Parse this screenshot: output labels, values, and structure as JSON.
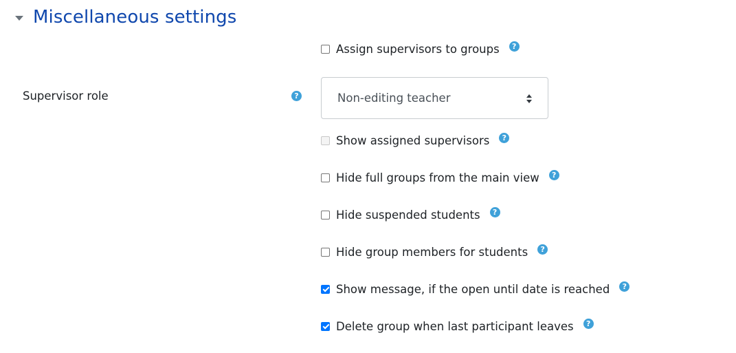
{
  "section": {
    "title": "Miscellaneous settings"
  },
  "supervisor_role": {
    "label": "Supervisor role",
    "selected": "Non-editing teacher"
  },
  "help_icon_glyph": "?",
  "checkboxes": [
    {
      "label": "Assign supervisors to groups",
      "checked": false,
      "disabled": false
    },
    {
      "label": "Show assigned supervisors",
      "checked": false,
      "disabled": true
    },
    {
      "label": "Hide full groups from the main view",
      "checked": false,
      "disabled": false
    },
    {
      "label": "Hide suspended students",
      "checked": false,
      "disabled": false
    },
    {
      "label": "Hide group members for students",
      "checked": false,
      "disabled": false
    },
    {
      "label": "Show message, if the open until date is reached",
      "checked": true,
      "disabled": false
    },
    {
      "label": "Delete group when last participant leaves",
      "checked": true,
      "disabled": false
    }
  ],
  "colors": {
    "title": "#0f47ad",
    "help_icon": "#3fa1d9",
    "checkbox_checked": "#0075ff"
  }
}
